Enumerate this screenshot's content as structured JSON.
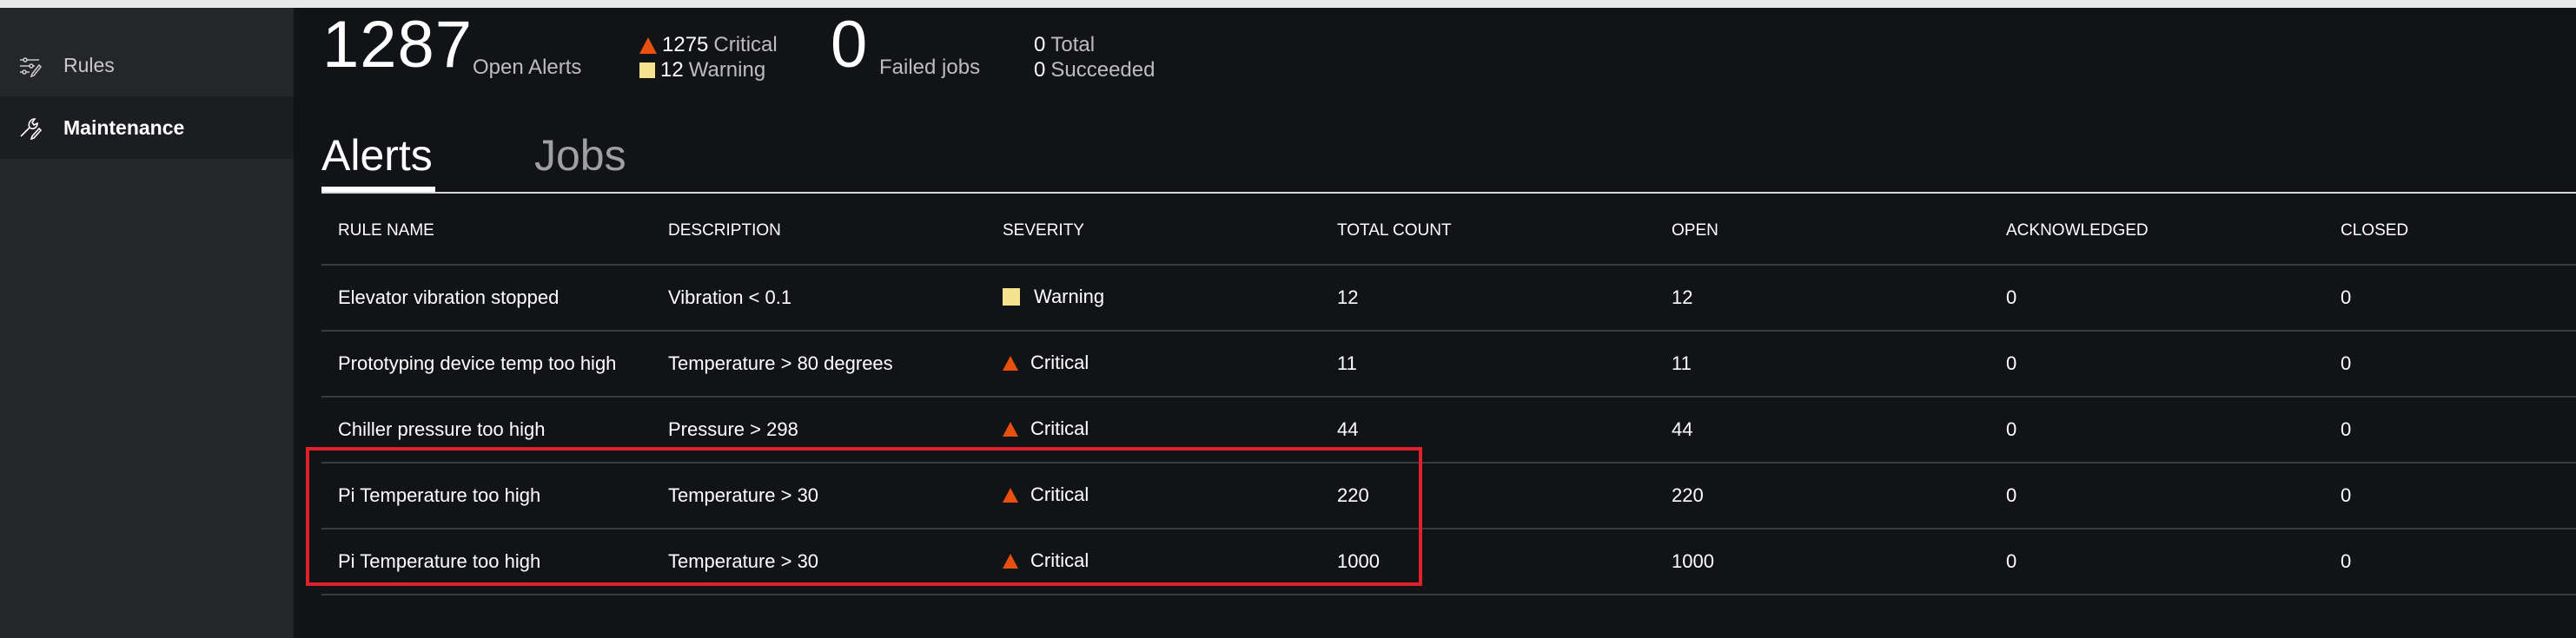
{
  "sidebar": {
    "items": [
      {
        "label": "Rules",
        "icon": "rules-icon",
        "active": false
      },
      {
        "label": "Maintenance",
        "icon": "maintenance-icon",
        "active": true
      }
    ]
  },
  "summary": {
    "open_alerts_count": "1287",
    "open_alerts_label": "Open Alerts",
    "critical_count": "1275",
    "critical_label": "Critical",
    "warning_count": "12",
    "warning_label": "Warning",
    "failed_jobs_count": "0",
    "failed_jobs_label": "Failed jobs",
    "total_count": "0",
    "total_label": "Total",
    "succeeded_count": "0",
    "succeeded_label": "Succeeded"
  },
  "tabs": [
    {
      "label": "Alerts",
      "active": true
    },
    {
      "label": "Jobs",
      "active": false
    }
  ],
  "table": {
    "headers": [
      "RULE NAME",
      "DESCRIPTION",
      "SEVERITY",
      "TOTAL COUNT",
      "OPEN",
      "ACKNOWLEDGED",
      "CLOSED"
    ],
    "rows": [
      {
        "rule": "Elevator vibration stopped",
        "description": "Vibration < 0.1",
        "severity": "Warning",
        "total": "12",
        "open": "12",
        "acknowledged": "0",
        "closed": "0"
      },
      {
        "rule": "Prototyping device temp too high",
        "description": "Temperature > 80 degrees",
        "severity": "Critical",
        "total": "11",
        "open": "11",
        "acknowledged": "0",
        "closed": "0"
      },
      {
        "rule": "Chiller pressure too high",
        "description": "Pressure > 298",
        "severity": "Critical",
        "total": "44",
        "open": "44",
        "acknowledged": "0",
        "closed": "0"
      },
      {
        "rule": "Pi Temperature too high",
        "description": "Temperature > 30",
        "severity": "Critical",
        "total": "220",
        "open": "220",
        "acknowledged": "0",
        "closed": "0"
      },
      {
        "rule": "Pi Temperature too high",
        "description": "Temperature > 30",
        "severity": "Critical",
        "total": "1000",
        "open": "1000",
        "acknowledged": "0",
        "closed": "0"
      }
    ]
  },
  "colors": {
    "critical": "#e8500f",
    "warning": "#f5e28c",
    "highlight_border": "#e0222a",
    "background": "#121316",
    "sidebar": "#252629"
  }
}
